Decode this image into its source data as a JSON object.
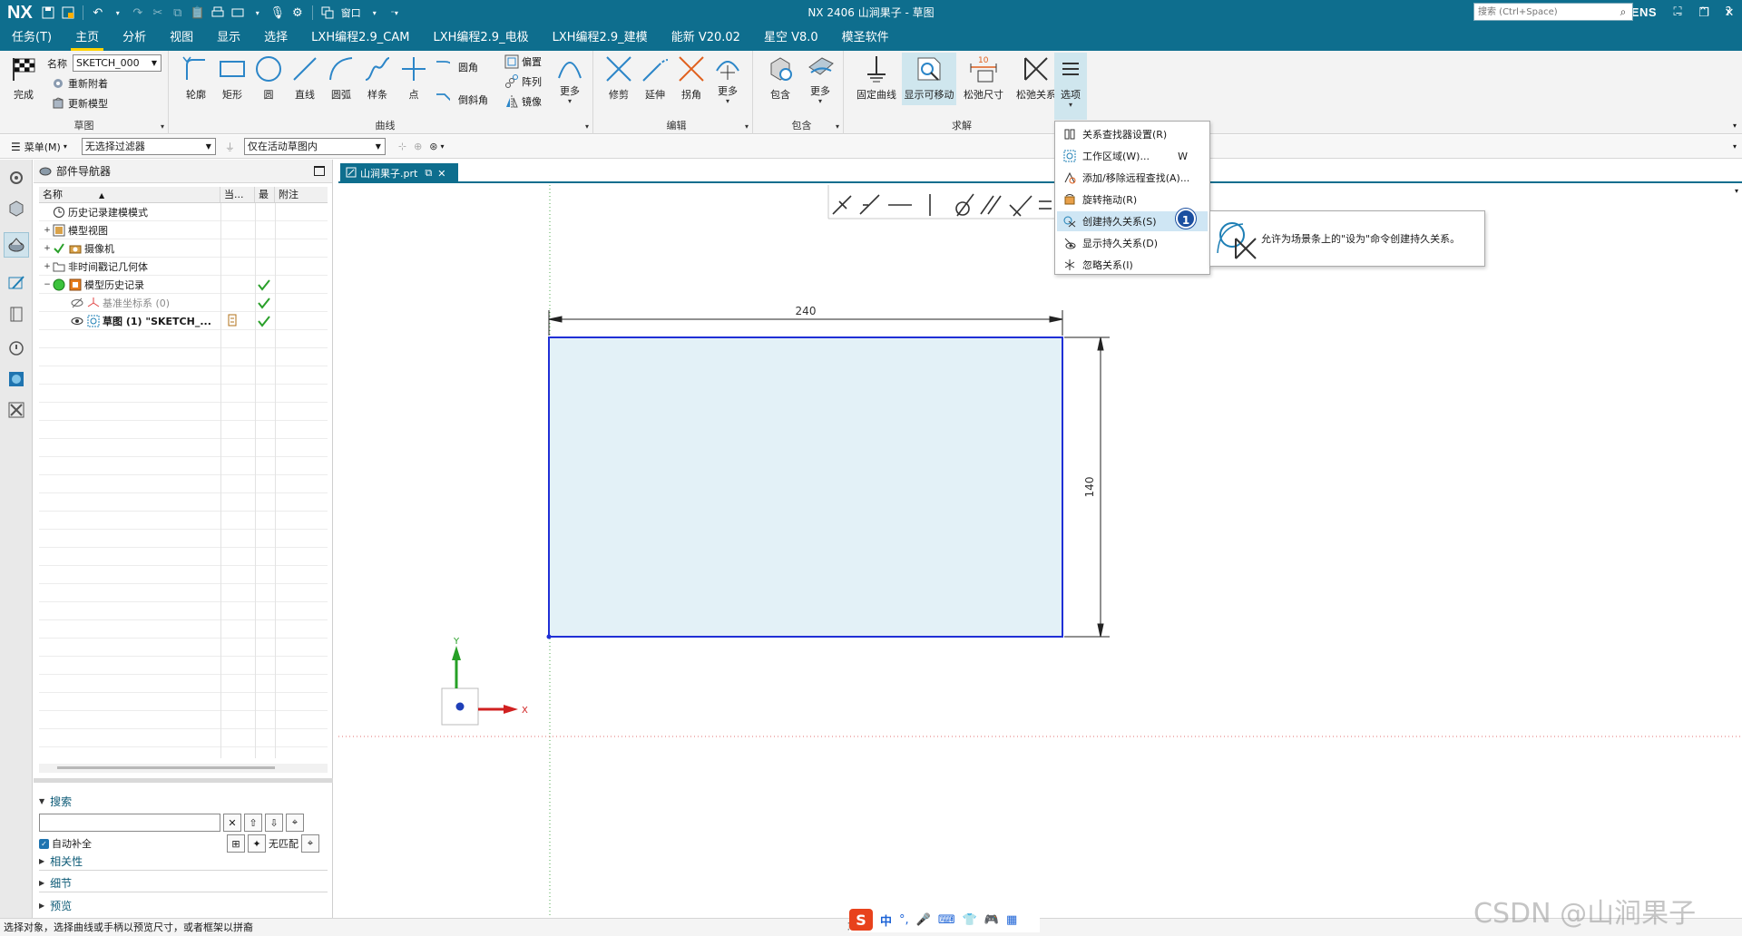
{
  "app": {
    "logo": "NX",
    "title": "NX 2406 山涧果子 - 草图",
    "brand": "SIEMENS",
    "window_menu": "窗口",
    "accent_color": "#0e6e8e"
  },
  "menu": {
    "items": [
      "任务(T)",
      "主页",
      "分析",
      "视图",
      "显示",
      "选择",
      "LXH编程2.9_CAM",
      "LXH编程2.9_电极",
      "LXH编程2.9_建模",
      "能新 V20.02",
      "星空 V8.0",
      "模圣软件"
    ],
    "active_index": 1,
    "search_placeholder": "搜索 (Ctrl+Space)"
  },
  "ribbon": {
    "sketch_group": {
      "finish": "完成",
      "name_label": "名称",
      "name_value": "SKETCH_000",
      "reattach": "重新附着",
      "update_model": "更新模型",
      "label": "草图"
    },
    "curve_group": {
      "label": "曲线",
      "profile": "轮廓",
      "rectangle": "矩形",
      "circle": "圆",
      "line": "直线",
      "arc": "圆弧",
      "spline": "样条",
      "point": "点",
      "fillet": "圆角",
      "chamfer": "倒斜角",
      "offset": "偏置",
      "pattern": "阵列",
      "mirror": "镜像",
      "more": "更多"
    },
    "edit_group": {
      "label": "编辑",
      "trim": "修剪",
      "extend": "延伸",
      "corner": "拐角",
      "more": "更多"
    },
    "contain_group": {
      "label": "包含",
      "contain": "包含",
      "more": "更多"
    },
    "solve_group": {
      "label": "求解",
      "fix_curve": "固定曲线",
      "show_movable": "显示可移动",
      "relax_dimension": "松弛尺寸",
      "relax_relation": "松弛关系",
      "dim_badge": "10"
    },
    "options": "选项"
  },
  "selection_bar": {
    "menu": "菜单(M)",
    "filter": "无选择过滤器",
    "scope": "仅在活动草图内"
  },
  "navigator": {
    "title": "部件导航器",
    "columns": [
      "名称",
      "当...",
      "最",
      "附注"
    ],
    "rows": [
      {
        "label": "历史记录建模模式",
        "expand": "",
        "check": false
      },
      {
        "label": "模型视图",
        "expand": "+",
        "check": false
      },
      {
        "label": "摄像机",
        "expand": "+",
        "check": false
      },
      {
        "label": "非时间戳记几何体",
        "expand": "+",
        "check": false
      },
      {
        "label": "模型历史记录",
        "expand": "−",
        "check": true
      },
      {
        "label": "基准坐标系 (0)",
        "expand": "",
        "check": true
      },
      {
        "label": "草图 (1) \"SKETCH_...",
        "expand": "",
        "check": true
      }
    ],
    "search_title": "搜索",
    "autocomplete": "自动补全",
    "no_match": "无匹配",
    "sections": [
      "相关性",
      "细节",
      "预览"
    ]
  },
  "document_tab": "山涧果子.prt",
  "sketch": {
    "width_dim": "240",
    "height_dim": "140",
    "axis_x": "X",
    "axis_y": "Y",
    "rect_fill": "#e3f1f7",
    "rect_stroke": "#1f2fd6"
  },
  "dropdown": {
    "items": [
      {
        "label": "关系查找器设置(R)",
        "key": ""
      },
      {
        "label": "工作区域(W)...",
        "key": "W"
      },
      {
        "label": "添加/移除远程查找(A)...",
        "key": ""
      },
      {
        "label": "旋转拖动(R)",
        "key": ""
      },
      {
        "label": "创建持久关系(S)",
        "key": ""
      },
      {
        "label": "显示持久关系(D)",
        "key": ""
      },
      {
        "label": "忽略关系(I)",
        "key": ""
      }
    ],
    "highlight_index": 4,
    "badge": "1",
    "tooltip": "允许为场景条上的\"设为\"命令创建持久关系。"
  },
  "status": {
    "text": "选择对象，选择曲线或手柄以预览尺寸，或者框架以拼裔",
    "mode": "草图"
  },
  "ime": {
    "lang": "中"
  },
  "watermark": "CSDN @山涧果子"
}
